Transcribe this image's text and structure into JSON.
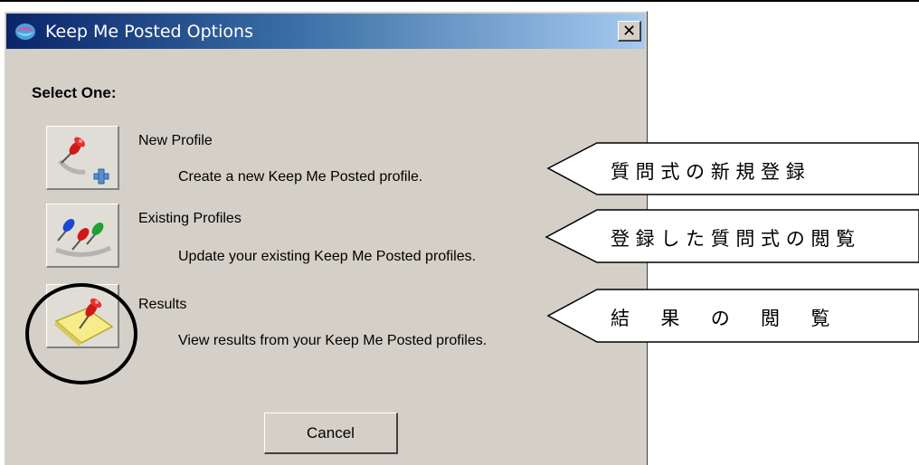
{
  "window": {
    "title": "Keep Me Posted Options",
    "close_glyph": "✕"
  },
  "dialog": {
    "select_label": "Select One:",
    "options": [
      {
        "title": "New Profile",
        "description": "Create a new Keep Me Posted profile.",
        "icon": "pushpin-plus-icon"
      },
      {
        "title": "Existing Profiles",
        "description": "Update your existing Keep Me Posted profiles.",
        "icon": "multiple-pushpins-icon"
      },
      {
        "title": "Results",
        "description": "View results from your Keep Me Posted profiles.",
        "icon": "pushpin-note-icon"
      }
    ],
    "cancel_label": "Cancel"
  },
  "annotations": {
    "callouts": [
      {
        "text": "質 問 式 の 新 規 登 録"
      },
      {
        "text": "登 録 し た 質 問 式 の 閲 覧"
      },
      {
        "text": "結 　 果 　 の 　 閲 　 覧"
      }
    ]
  },
  "colors": {
    "titlebar_start": "#0a246a",
    "titlebar_end": "#a6caf0",
    "dialog_bg": "#d4d0c8"
  }
}
